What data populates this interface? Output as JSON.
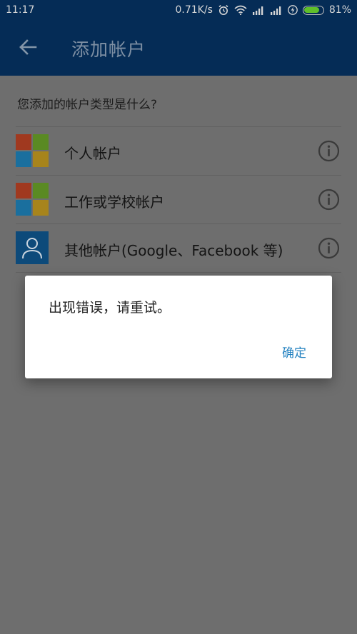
{
  "status_bar": {
    "time": "11:17",
    "network_speed": "0.71K/s",
    "battery_percent_text": "81%",
    "battery_level": 0.81,
    "battery_color": "#5fbf2a",
    "icons": [
      "alarm-icon",
      "wifi-icon",
      "signal-icon",
      "signal-icon",
      "charging-icon",
      "battery-icon"
    ]
  },
  "app_bar": {
    "title": "添加帐户",
    "back_icon": "arrow-left-icon",
    "background": "#052c56"
  },
  "content": {
    "question": "您添加的帐户类型是什么?",
    "options": [
      {
        "label": "个人帐户",
        "icon": "microsoft-logo-icon"
      },
      {
        "label": "工作或学校帐户",
        "icon": "microsoft-logo-icon"
      },
      {
        "label": "其他帐户(Google、Facebook 等)",
        "icon": "person-icon"
      }
    ],
    "info_icon": "info-icon"
  },
  "dialog": {
    "message": "出现错误，请重试。",
    "ok_label": "确定",
    "ok_color": "#1f7fbf"
  }
}
